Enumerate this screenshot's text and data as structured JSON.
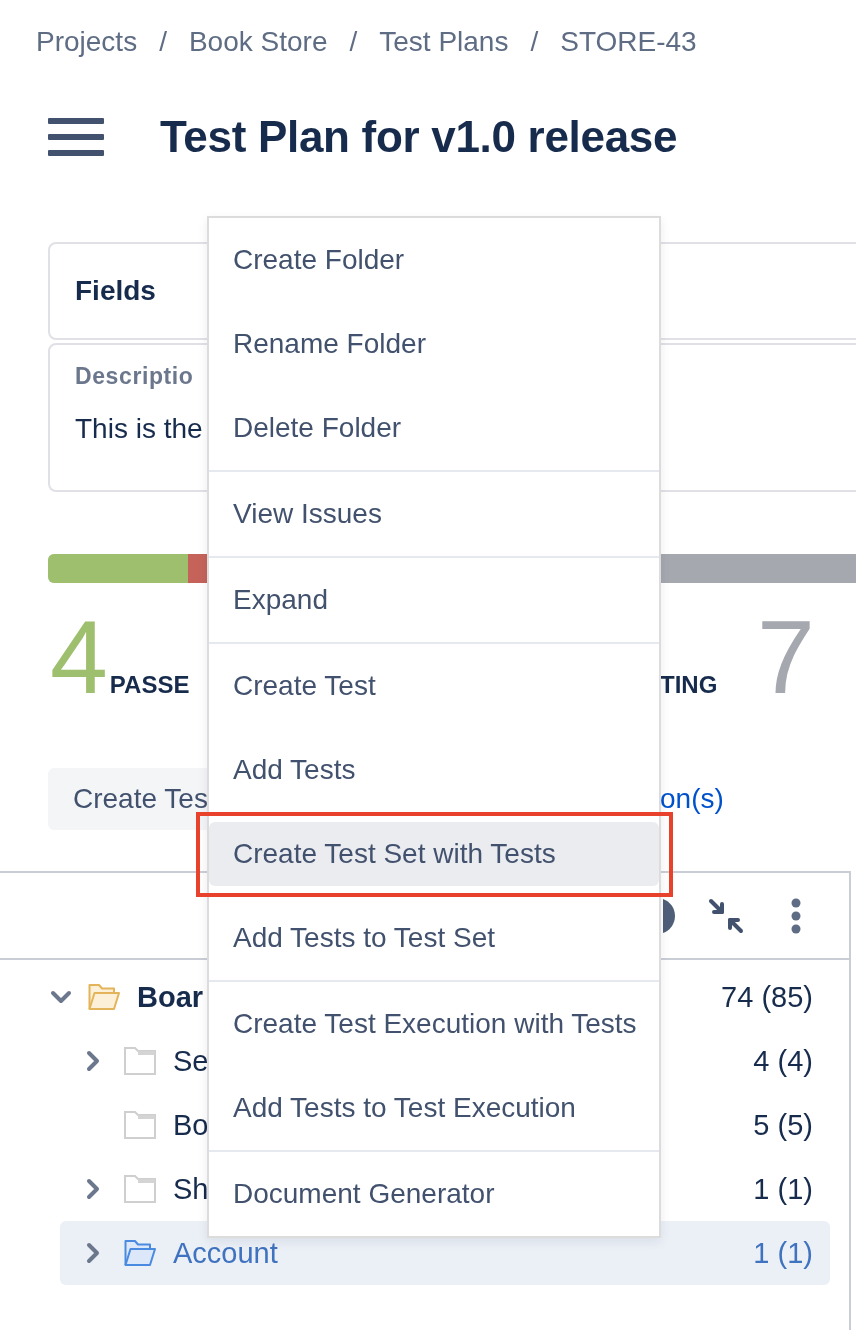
{
  "breadcrumb": {
    "items": [
      "Projects",
      "Book Store",
      "Test Plans",
      "STORE-43"
    ],
    "separators": [
      "/",
      "/",
      "/"
    ]
  },
  "page_title": "Test Plan for v1.0 release",
  "fields_panel": {
    "title": "Fields"
  },
  "description": {
    "label": "Descriptio",
    "text": "This is the"
  },
  "progress": {
    "segments": [
      {
        "color": "#9ebf6d",
        "level": 0.163
      },
      {
        "color": "#c5635a",
        "level": 0.03
      },
      {
        "color": "#a5a8af",
        "level": 0.807
      }
    ]
  },
  "stats": [
    {
      "count": "4",
      "label": "PASSE",
      "color": "#9ebf6d"
    },
    {
      "label": "TING"
    },
    {
      "count": "7",
      "color": "#a5a8af"
    }
  ],
  "actions": {
    "button": "Create Tes",
    "link": "on(s)"
  },
  "tree": [
    {
      "name": "Boar",
      "count": "74 (85)",
      "has_children": true,
      "expanded": true,
      "selected": false,
      "children": [
        {
          "name": "Se",
          "count": "4 (4)",
          "has_children": true,
          "expanded": false,
          "selected": false
        },
        {
          "name": "Bo",
          "count": "5 (5)",
          "has_children": false,
          "expanded": false,
          "selected": false
        },
        {
          "name": "Sh",
          "count": "1 (1)",
          "has_children": true,
          "expanded": false,
          "selected": false
        },
        {
          "name": "Account",
          "count": "1 (1)",
          "has_children": true,
          "expanded": false,
          "selected": true
        }
      ]
    }
  ],
  "context_menu": {
    "groups": [
      {
        "items": [
          {
            "label": "Create Folder",
            "selected": false,
            "outlined": false
          },
          {
            "label": "Rename Folder",
            "selected": false,
            "outlined": false
          },
          {
            "label": "Delete Folder",
            "selected": false,
            "outlined": false
          }
        ]
      },
      {
        "items": [
          {
            "label": "View Issues",
            "selected": false,
            "outlined": false
          }
        ]
      },
      {
        "items": [
          {
            "label": "Expand",
            "selected": false,
            "outlined": false
          }
        ]
      },
      {
        "items": [
          {
            "label": "Create Test",
            "selected": false,
            "outlined": false
          },
          {
            "label": "Add Tests",
            "selected": false,
            "outlined": false
          },
          {
            "label": "Create Test Set with Tests",
            "selected": true,
            "outlined": true
          },
          {
            "label": "Add Tests to Test Set",
            "selected": false,
            "outlined": false
          }
        ]
      },
      {
        "items": [
          {
            "label": "Create Test Execution with Tests",
            "selected": false,
            "outlined": false
          },
          {
            "label": "Add Tests to Test Execution",
            "selected": false,
            "outlined": false
          }
        ]
      },
      {
        "items": [
          {
            "label": "Document Generator",
            "selected": false,
            "outlined": false
          }
        ]
      }
    ]
  }
}
